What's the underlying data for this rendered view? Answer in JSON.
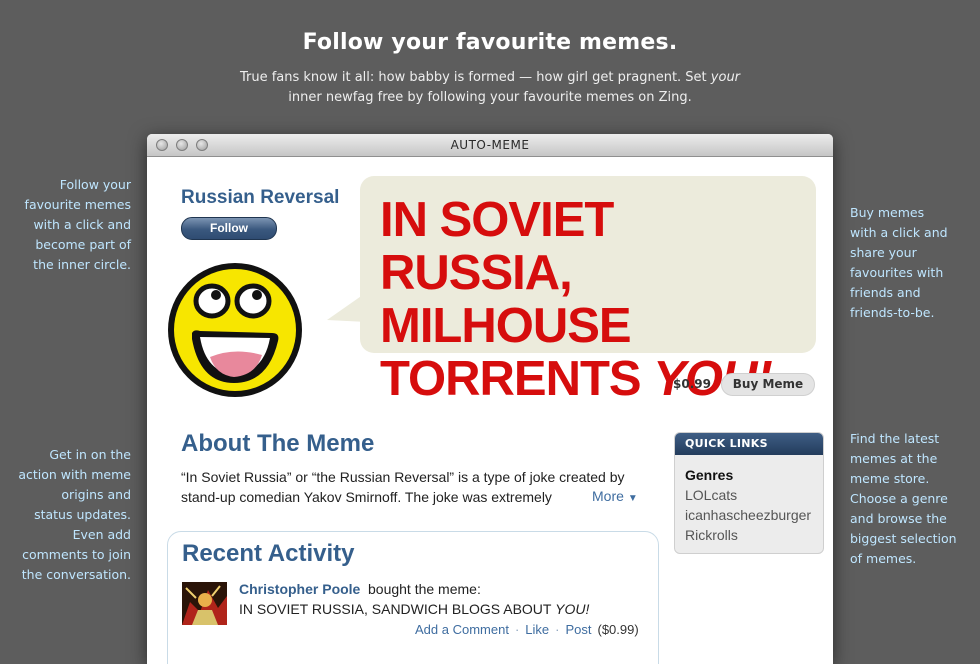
{
  "hero": {
    "title": "Follow your favourite memes.",
    "subtitle_line1": "True fans know it all: how babby is formed — how girl get pragnent. Set ",
    "subtitle_emph": "your",
    "subtitle_line2": "inner newfag free by following your favourite memes on Zing."
  },
  "side_notes": {
    "follow": [
      "Follow your",
      "favourite memes",
      "with a click and",
      "become part of",
      "the inner circle."
    ],
    "buy": [
      "Buy memes",
      "with a click and",
      "share your",
      "favourites with",
      "friends and",
      "friends-to-be."
    ],
    "action": [
      "Get in on the",
      "action with meme",
      "origins and",
      "status updates.",
      "Even add",
      "comments to join",
      "the conversation."
    ],
    "latest": [
      "Find the latest",
      "memes at the",
      "meme store.",
      "Choose a genre",
      "and browse the",
      "biggest selection",
      "of memes."
    ]
  },
  "window": {
    "title": "AUTO-MEME"
  },
  "meme": {
    "name": "Russian Reversal",
    "follow_label": "Follow",
    "avatar_icon": "awesome-smiley-icon",
    "caption_line1": "IN SOVIET RUSSIA,",
    "caption_line2": "MILHOUSE",
    "caption_line3_plain": "TORRENTS ",
    "caption_line3_emph": "YOU!",
    "caption_color": "#d60d0d",
    "price": "$0.99",
    "buy_label": "Buy Meme"
  },
  "about": {
    "heading": "About The Meme",
    "text": "“In Soviet Russia” or “the Russian Reversal” is a type of joke created by stand-up comedian Yakov Smirnoff. The joke was extremely",
    "more_label": "More"
  },
  "activity": {
    "heading": "Recent Activity",
    "items": [
      {
        "user": "Christopher Poole",
        "verb": "bought the meme:",
        "meme_plain": "IN SOVIET RUSSIA, SANDWICH BLOGS ABOUT ",
        "meme_emph": "YOU!",
        "links": [
          "Add a Comment",
          "Like",
          "Post"
        ],
        "price": "($0.99)"
      }
    ]
  },
  "quick_links": {
    "title": "QUICK LINKS",
    "section": "Genres",
    "items": [
      "LOLcats",
      "icanhascheezburger",
      "Rickrolls"
    ]
  },
  "colors": {
    "background": "#5d5d5d",
    "side_note": "#bfe6ff",
    "heading_blue": "#355f8c",
    "link_blue": "#3f6da0"
  }
}
